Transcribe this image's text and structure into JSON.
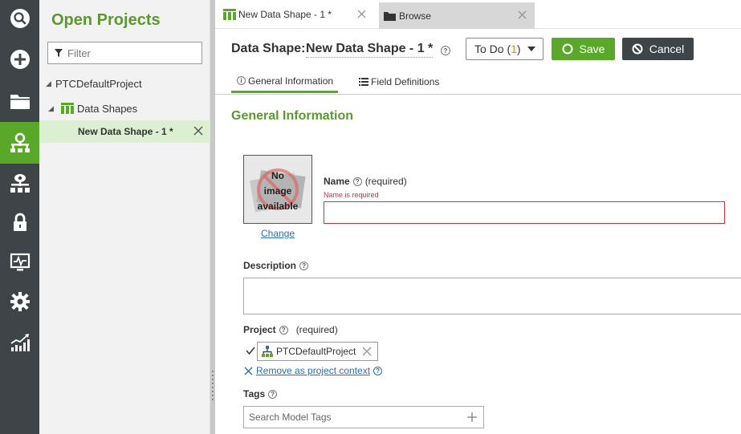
{
  "rail": {
    "items": [
      {
        "icon": "search-icon"
      },
      {
        "icon": "add-icon"
      },
      {
        "icon": "folder-icon"
      },
      {
        "icon": "model-tree-icon",
        "active": true
      },
      {
        "icon": "visibility-tree-icon"
      },
      {
        "icon": "lock-icon"
      },
      {
        "icon": "monitoring-icon"
      },
      {
        "icon": "settings-icon"
      },
      {
        "icon": "analytics-icon"
      }
    ],
    "active_color": "#5aa82a"
  },
  "projects": {
    "title": "Open Projects",
    "filter_placeholder": "Filter",
    "tree": {
      "project": "PTCDefaultProject",
      "category": "Data Shapes",
      "item": "New Data Shape - 1 *"
    }
  },
  "tabs": [
    {
      "label": "New Data Shape - 1 *",
      "icon": "data-shape-icon",
      "active": true
    },
    {
      "label": "Browse",
      "icon": "folder-icon",
      "active": false
    }
  ],
  "header": {
    "entity_type_label": "Data Shape:",
    "entity_name": "New Data Shape - 1 *",
    "todo_label": "To Do (",
    "todo_count": "1",
    "todo_close": ")",
    "save_label": "Save",
    "cancel_label": "Cancel"
  },
  "subtabs": [
    {
      "label": "General Information",
      "active": true
    },
    {
      "label": "Field Definitions",
      "active": false
    }
  ],
  "general": {
    "section_title": "General Information",
    "image_placeholder": [
      "No",
      "image",
      "available"
    ],
    "change_link": "Change",
    "name_label": "Name",
    "name_required": "(required)",
    "name_error": "Name is required",
    "name_value": "",
    "description_label": "Description",
    "description_value": "",
    "project_label": "Project",
    "project_required": "(required)",
    "project_value": "PTCDefaultProject",
    "remove_context_link": "Remove as project context",
    "tags_label": "Tags",
    "tags_placeholder": "Search Model Tags"
  },
  "colors": {
    "brand_green": "#5aa82a",
    "dark": "#3e4447",
    "error_red": "#c9353c",
    "link_blue": "#2a6fb0",
    "todo_orange": "#e8891b"
  }
}
